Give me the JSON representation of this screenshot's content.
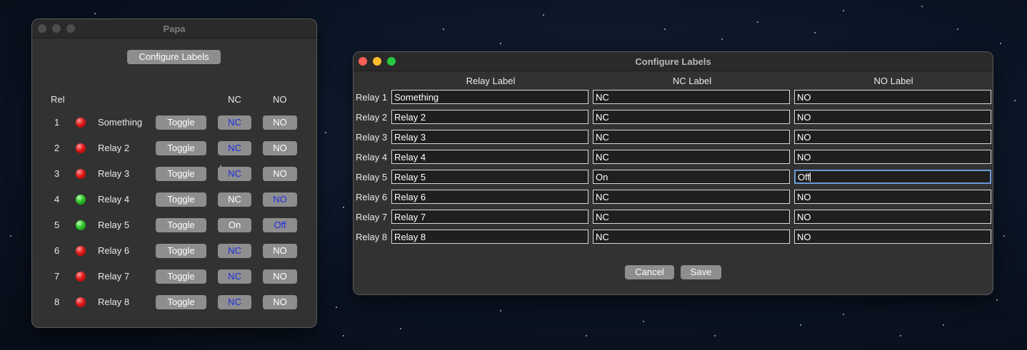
{
  "papa": {
    "title": "Papa",
    "configure_label": "Configure Labels",
    "col_rel": "Rel",
    "col_nc": "NC",
    "col_no": "NO",
    "toggle_label": "Toggle",
    "relays": [
      {
        "num": "1",
        "name": "Something",
        "led": "red",
        "nc": "NC",
        "no": "NO",
        "active": "nc"
      },
      {
        "num": "2",
        "name": "Relay 2",
        "led": "red",
        "nc": "NC",
        "no": "NO",
        "active": "nc"
      },
      {
        "num": "3",
        "name": "Relay 3",
        "led": "red",
        "nc": "NC",
        "no": "NO",
        "active": "nc"
      },
      {
        "num": "4",
        "name": "Relay 4",
        "led": "green",
        "nc": "NC",
        "no": "NO",
        "active": "no"
      },
      {
        "num": "5",
        "name": "Relay 5",
        "led": "green",
        "nc": "On",
        "no": "Off",
        "active": "no"
      },
      {
        "num": "6",
        "name": "Relay 6",
        "led": "red",
        "nc": "NC",
        "no": "NO",
        "active": "nc"
      },
      {
        "num": "7",
        "name": "Relay 7",
        "led": "red",
        "nc": "NC",
        "no": "NO",
        "active": "nc"
      },
      {
        "num": "8",
        "name": "Relay 8",
        "led": "red",
        "nc": "NC",
        "no": "NO",
        "active": "nc"
      }
    ]
  },
  "configure": {
    "title": "Configure Labels",
    "headers": {
      "relay": "Relay Label",
      "nc": "NC Label",
      "no": "NO Label"
    },
    "rows": [
      {
        "label": "Relay 1",
        "relay": "Something",
        "nc": "NC",
        "no": "NO"
      },
      {
        "label": "Relay 2",
        "relay": "Relay 2",
        "nc": "NC",
        "no": "NO"
      },
      {
        "label": "Relay 3",
        "relay": "Relay 3",
        "nc": "NC",
        "no": "NO"
      },
      {
        "label": "Relay 4",
        "relay": "Relay 4",
        "nc": "NC",
        "no": "NO"
      },
      {
        "label": "Relay 5",
        "relay": "Relay 5",
        "nc": "On",
        "no": "Off"
      },
      {
        "label": "Relay 6",
        "relay": "Relay 6",
        "nc": "NC",
        "no": "NO"
      },
      {
        "label": "Relay 7",
        "relay": "Relay 7",
        "nc": "NC",
        "no": "NO"
      },
      {
        "label": "Relay 8",
        "relay": "Relay 8",
        "nc": "NC",
        "no": "NO"
      }
    ],
    "cancel_label": "Cancel",
    "save_label": "Save"
  },
  "colors": {
    "led_red": "#e01a1a",
    "led_green": "#2ec42a",
    "active_text": "#1f2fe0",
    "button_gray": "#8e8e8e"
  }
}
